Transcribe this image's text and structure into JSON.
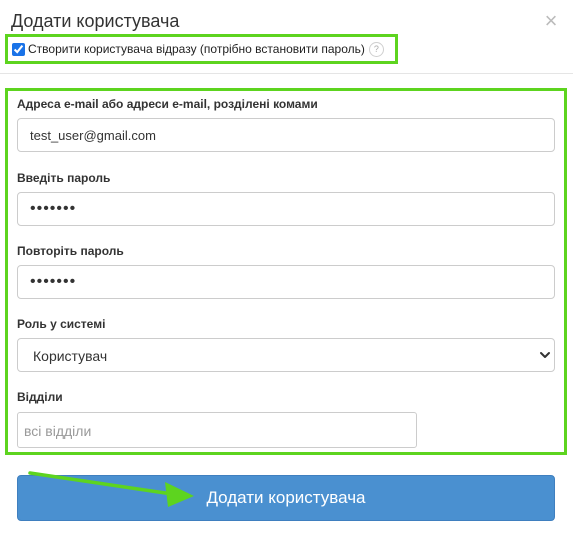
{
  "dialog": {
    "title": "Додати користувача",
    "close_icon": "×"
  },
  "create_now": {
    "checked": true,
    "label": "Створити користувача відразу (потрібно встановити пароль)",
    "help_icon": "?"
  },
  "form": {
    "email": {
      "label": "Адреса e-mail або адреси e-mail, розділені комами",
      "value": "test_user@gmail.com"
    },
    "password": {
      "label": "Введіть пароль",
      "masked": "•••••••"
    },
    "password_repeat": {
      "label": "Повторіть пароль",
      "masked": "•••••••"
    },
    "role": {
      "label": "Роль у системі",
      "selected": "Користувач"
    },
    "departments": {
      "label": "Відділи",
      "placeholder": "всі відділи"
    }
  },
  "submit_button": {
    "label": "Додати користувача"
  },
  "annotation_colors": {
    "highlight": "#5dd41f",
    "button": "#4a90d0"
  }
}
